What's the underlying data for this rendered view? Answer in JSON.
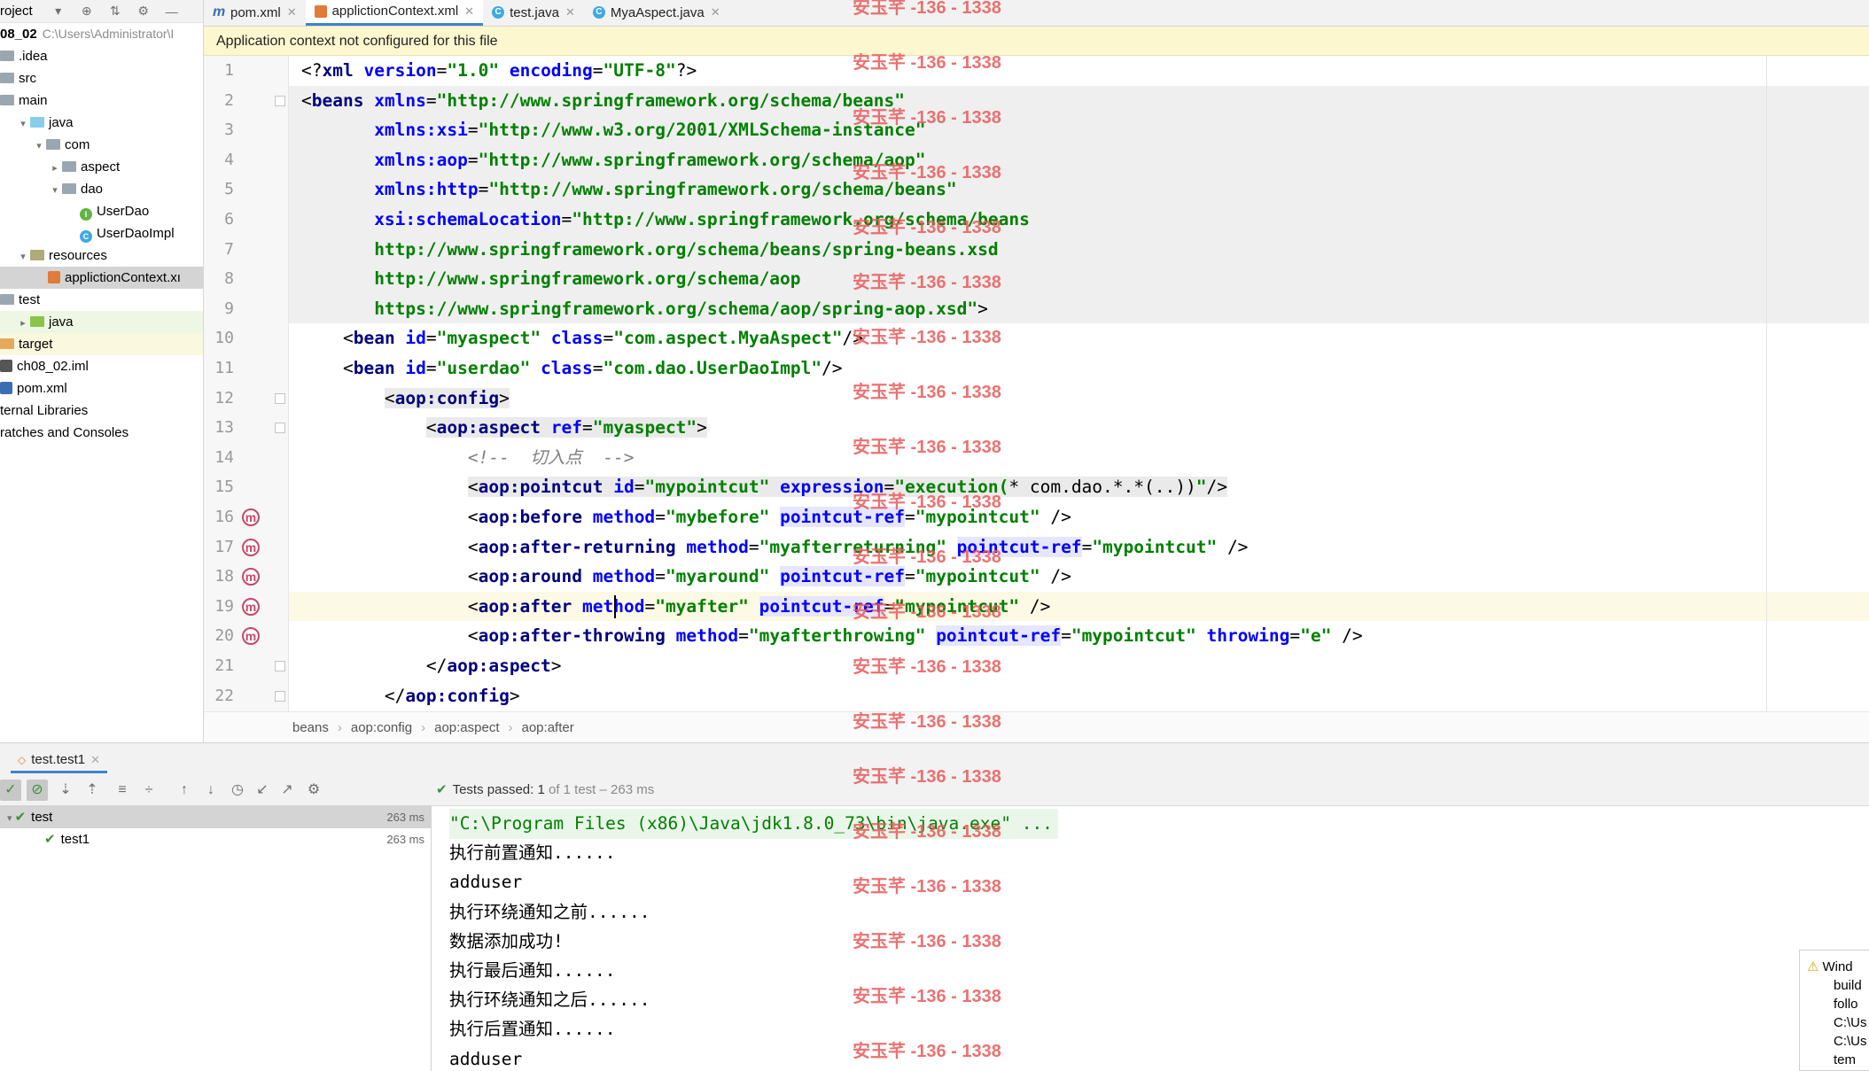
{
  "project": {
    "title": "roject",
    "items": [
      {
        "label": "08_02",
        "path": "C:\\Users\\Administrator\\I",
        "indent": 0,
        "type": "root"
      },
      {
        "label": ".idea",
        "indent": 0,
        "type": "folder"
      },
      {
        "label": "src",
        "indent": 0,
        "type": "folder"
      },
      {
        "label": "main",
        "indent": 0,
        "type": "folder"
      },
      {
        "label": "java",
        "indent": 1,
        "type": "src",
        "arrow": "⌄"
      },
      {
        "label": "com",
        "indent": 2,
        "type": "folder",
        "arrow": "⌄"
      },
      {
        "label": "aspect",
        "indent": 3,
        "type": "folder",
        "arrow": "›"
      },
      {
        "label": "dao",
        "indent": 3,
        "type": "folder",
        "arrow": "⌄"
      },
      {
        "label": "UserDao",
        "indent": 5,
        "type": "iface"
      },
      {
        "label": "UserDaoImpl",
        "indent": 5,
        "type": "cls"
      },
      {
        "label": "resources",
        "indent": 1,
        "type": "res",
        "arrow": "⌄"
      },
      {
        "label": "applictionContext.xı",
        "indent": 3,
        "type": "xml"
      },
      {
        "label": "test",
        "indent": 0,
        "type": "folder"
      },
      {
        "label": "java",
        "indent": 1,
        "type": "tst",
        "arrow": "›"
      },
      {
        "label": "target",
        "indent": 0,
        "type": "tgt"
      },
      {
        "label": "ch08_02.iml",
        "indent": 0,
        "type": "iml"
      },
      {
        "label": "pom.xml",
        "indent": 0,
        "type": "mvn"
      },
      {
        "label": "ternal Libraries",
        "indent": 0,
        "type": "plain"
      },
      {
        "label": "ratches and Consoles",
        "indent": 0,
        "type": "plain"
      }
    ]
  },
  "tabs": [
    {
      "label": "pom.xml",
      "icon": "m"
    },
    {
      "label": "applictionContext.xml",
      "icon": "x",
      "active": true
    },
    {
      "label": "test.java",
      "icon": "c"
    },
    {
      "label": "MyaAspect.java",
      "icon": "c"
    }
  ],
  "banner": "Application context not configured for this file",
  "code_lines": [
    {
      "n": "1",
      "html": "<span class='p'>&lt;?</span><span class='k'>xml </span><span class='a'>version</span><span class='p'>=</span><span class='v'>\"1.0\" </span><span class='a'>encoding</span><span class='p'>=</span><span class='v'>\"UTF-8\"</span><span class='p'>?&gt;</span>"
    },
    {
      "n": "2",
      "html": "<span class='p'>&lt;</span><span class='k'>beans </span><span class='a'>xmlns</span><span class='p'>=</span><span class='v'>\"http://www.springframework.org/schema/beans\"</span>"
    },
    {
      "n": "3",
      "html": "       <span class='a'>xmlns:xsi</span><span class='p'>=</span><span class='v'>\"http://www.w3.org/2001/XMLSchema-instance\"</span>"
    },
    {
      "n": "4",
      "html": "       <span class='a'>xmlns:aop</span><span class='p'>=</span><span class='v'>\"http://www.springframework.org/schema/aop\"</span>"
    },
    {
      "n": "5",
      "html": "       <span class='a'>xmlns:http</span><span class='p'>=</span><span class='v'>\"http://www.springframework.org/schema/beans\"</span>"
    },
    {
      "n": "6",
      "html": "       <span class='a'>xsi:schemaLocation</span><span class='p'>=</span><span class='v'>\"http://www.springframework.org/schema/beans</span>"
    },
    {
      "n": "7",
      "html": "       <span class='v'>http://www.springframework.org/schema/beans/spring-beans.xsd</span>"
    },
    {
      "n": "8",
      "html": "       <span class='v'>http://www.springframework.org/schema/aop</span>"
    },
    {
      "n": "9",
      "html": "       <span class='v'>https://www.springframework.org/schema/aop/spring-aop.xsd\"</span><span class='p'>&gt;</span>"
    },
    {
      "n": "10",
      "html": "    <span class='p'>&lt;</span><span class='k'>bean </span><span class='a'>id</span><span class='p'>=</span><span class='v'>\"myaspect\" </span><span class='a'>class</span><span class='p'>=</span><span class='v'>\"com.aspect.MyaAspect\"</span><span class='p'>/&gt;</span>"
    },
    {
      "n": "11",
      "html": "    <span class='p'>&lt;</span><span class='k'>bean </span><span class='a'>id</span><span class='p'>=</span><span class='v'>\"userdao\" </span><span class='a'>class</span><span class='p'>=</span><span class='v'>\"com.dao.UserDaoImpl\"</span><span class='p'>/&gt;</span>"
    },
    {
      "n": "12",
      "html": "        <span class='hl-tag'><span class='p'>&lt;</span><span class='k'>aop:config</span><span class='p'>&gt;</span></span>"
    },
    {
      "n": "13",
      "html": "            <span class='hl-tag'><span class='p'>&lt;</span><span class='k'>aop:aspect </span><span class='a'>ref</span><span class='p'>=</span><span class='v'>\"myaspect\"</span><span class='p'>&gt;</span></span>"
    },
    {
      "n": "14",
      "html": "                <span class='cm'>&lt;!--  切入点  --&gt;</span>"
    },
    {
      "n": "15",
      "html": "                <span class='hl-tag'><span class='p'>&lt;</span><span class='k'>aop:pointcut </span><span class='a'>id</span><span class='p'>=</span><span class='v'>\"mypointcut\" </span><span class='a'>expression</span><span class='p'>=</span><span class='v'>\"execution(</span><span class='p'>* com.dao.*.*(..))</span><span class='v'>\"</span><span class='p'>/&gt;</span></span>"
    },
    {
      "n": "16",
      "html": "                <span class='p'>&lt;</span><span class='k'>aop:before </span><span class='a'>method</span><span class='p'>=</span><span class='v'>\"mybefore\" </span><span class='hl-attr'><span class='a'>pointcut-ref</span></span><span class='p'>=</span><span class='v'>\"mypointcut\" </span><span class='p'>/&gt;</span>",
      "mk": true
    },
    {
      "n": "17",
      "html": "                <span class='p'>&lt;</span><span class='k'>aop:after-returning </span><span class='a'>method</span><span class='p'>=</span><span class='v'>\"myafterreturning\" </span><span class='hl-attr'><span class='a'>pointcut-ref</span></span><span class='p'>=</span><span class='v'>\"mypointcut\" </span><span class='p'>/&gt;</span>",
      "mk": true
    },
    {
      "n": "18",
      "html": "                <span class='p'>&lt;</span><span class='k'>aop:around </span><span class='a'>method</span><span class='p'>=</span><span class='v'>\"myaround\" </span><span class='hl-attr'><span class='a'>pointcut-ref</span></span><span class='p'>=</span><span class='v'>\"mypointcut\" </span><span class='p'>/&gt;</span>",
      "mk": true
    },
    {
      "n": "19",
      "html": "                <span class='p'>&lt;</span><span class='k'>aop:after </span><span class='a'>method</span><span class='p'>=</span><span class='v'>\"myafter\" </span><span class='hl-attr'><span class='a'>pointcut-ref</span></span><span class='p'>=</span><span class='v'>\"mypointcut\" </span><span class='p'>/&gt;</span>",
      "mk": true,
      "cur": true
    },
    {
      "n": "20",
      "html": "                <span class='p'>&lt;</span><span class='k'>aop:after-throwing </span><span class='a'>method</span><span class='p'>=</span><span class='v'>\"myafterthrowing\" </span><span class='hl-attr'><span class='a'>pointcut-ref</span></span><span class='p'>=</span><span class='v'>\"mypointcut\" </span><span class='a'>throwing</span><span class='p'>=</span><span class='v'>\"e\" </span><span class='p'>/&gt;</span>",
      "mk": true
    },
    {
      "n": "21",
      "html": "            <span class='p'>&lt;/</span><span class='k'>aop:aspect</span><span class='p'>&gt;</span>"
    },
    {
      "n": "22",
      "html": "        <span class='p'>&lt;/</span><span class='k'>aop:config</span><span class='p'>&gt;</span>"
    }
  ],
  "breadcrumb": [
    "beans",
    "aop:config",
    "aop:aspect",
    "aop:after"
  ],
  "run": {
    "tab_label": "test.test1",
    "status_ok": "Tests passed:",
    "status_count": "1",
    "status_detail": "of 1 test – 263 ms",
    "tree": [
      {
        "label": "test",
        "ms": "263 ms",
        "selected": true
      },
      {
        "label": "test1",
        "ms": "263 ms"
      }
    ],
    "console": [
      "\"C:\\Program Files (x86)\\Java\\jdk1.8.0_73\\bin\\java.exe\" ...",
      "执行前置通知......",
      "adduser",
      "执行环绕通知之前......",
      "数据添加成功!",
      "执行最后通知......",
      "执行环绕通知之后......",
      "执行后置通知......",
      "adduser"
    ]
  },
  "notification": [
    "Wind",
    "build",
    "follo",
    "C:\\Us",
    "C:\\Us",
    "tem"
  ],
  "watermark": "安玉芊 -136 - 1338"
}
